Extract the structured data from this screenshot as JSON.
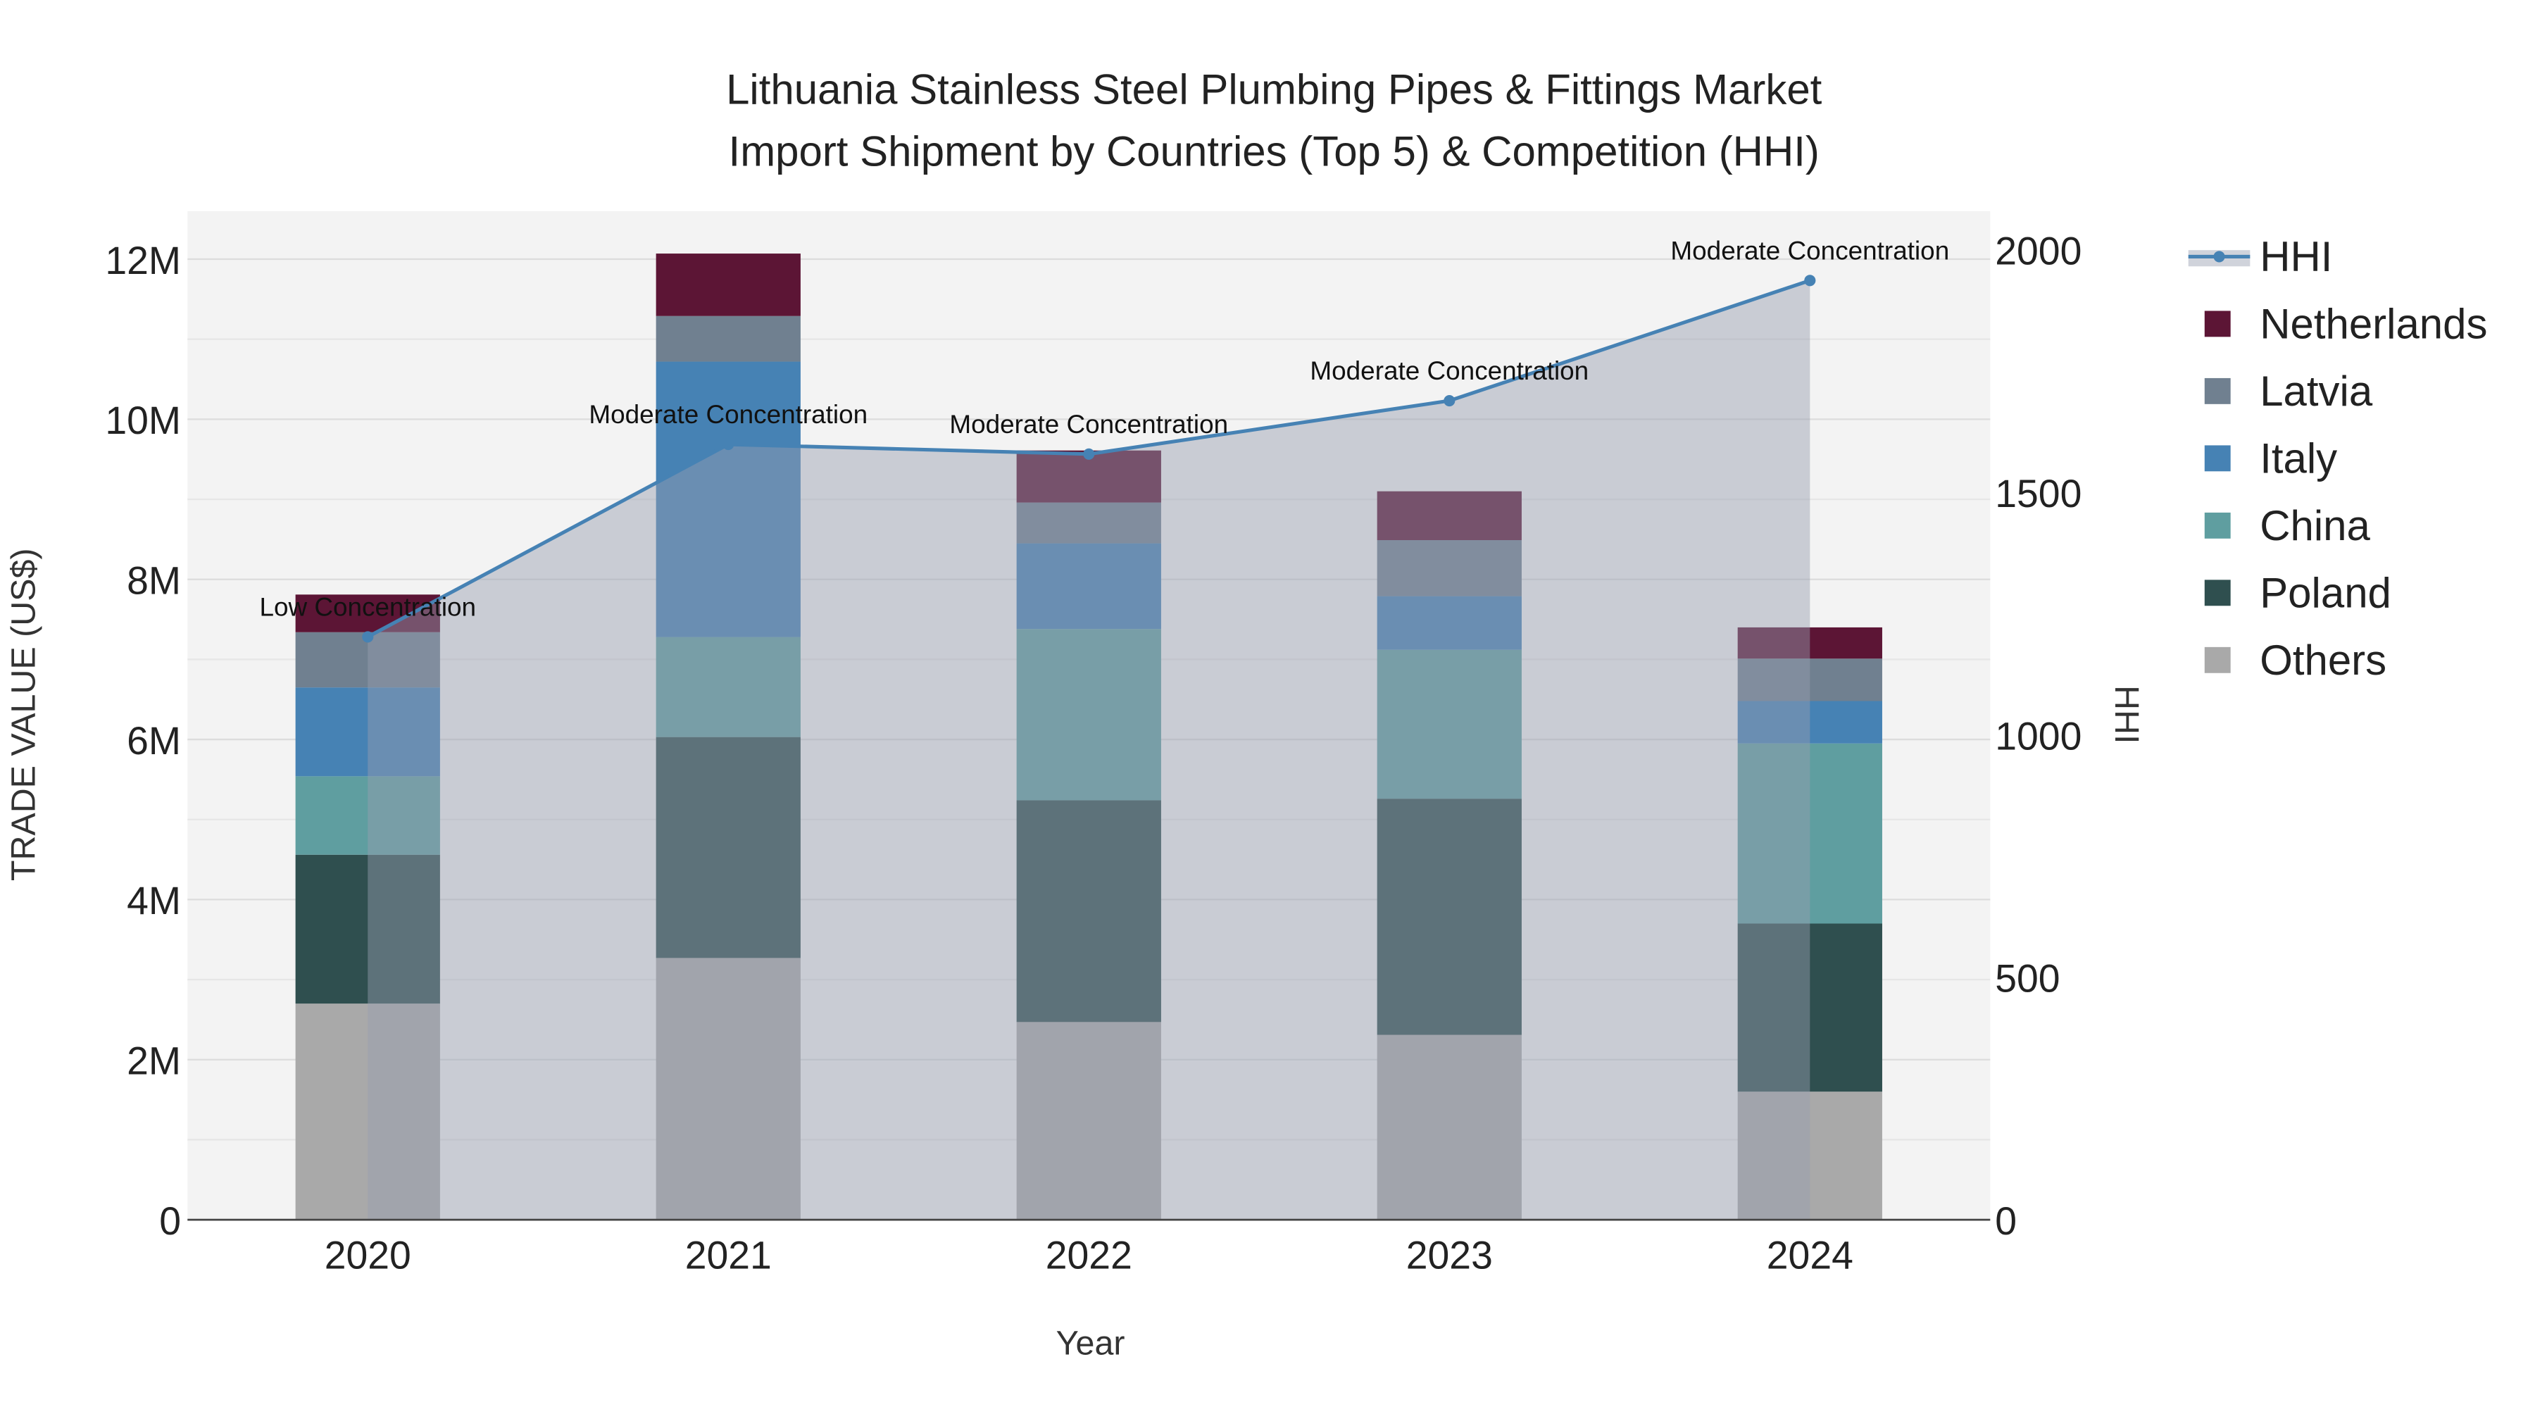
{
  "chart_data": {
    "type": "bar",
    "stacked": true,
    "title": [
      "Lithuania Stainless Steel Plumbing Pipes & Fittings Market",
      "Import Shipment by Countries (Top 5) & Competition (HHI)"
    ],
    "xlabel": "Year",
    "ylabel": "TRADE VALUE (US$)",
    "y2label": "HHI",
    "categories": [
      "2020",
      "2021",
      "2022",
      "2023",
      "2024"
    ],
    "ylim": [
      0,
      12600000
    ],
    "y2lim": [
      0,
      2080
    ],
    "yticks": [
      0,
      2000000,
      4000000,
      6000000,
      8000000,
      10000000,
      12000000
    ],
    "ytick_labels": [
      "0",
      "2M",
      "4M",
      "6M",
      "8M",
      "10M",
      "12M"
    ],
    "y2ticks": [
      0,
      500,
      1000,
      1500,
      2000
    ],
    "y2tick_labels": [
      "0",
      "500",
      "1000",
      "1500",
      "2000"
    ],
    "series": [
      {
        "name": "Others",
        "color": "#a9a9a9",
        "values": [
          2700000,
          3270000,
          2470000,
          2310000,
          1600000
        ]
      },
      {
        "name": "Poland",
        "color": "#2f4f4f",
        "values": [
          1860000,
          2760000,
          2770000,
          2950000,
          2100000
        ]
      },
      {
        "name": "China",
        "color": "#5f9ea0",
        "values": [
          980000,
          1250000,
          2140000,
          1860000,
          2250000
        ]
      },
      {
        "name": "Italy",
        "color": "#4682b4",
        "values": [
          1110000,
          3440000,
          1070000,
          670000,
          530000
        ]
      },
      {
        "name": "Latvia",
        "color": "#708090",
        "values": [
          690000,
          570000,
          510000,
          700000,
          530000
        ]
      },
      {
        "name": "Netherlands",
        "color": "#5c1535",
        "values": [
          470000,
          780000,
          650000,
          610000,
          390000
        ]
      }
    ],
    "line": {
      "name": "HHI",
      "color": "#4682b4",
      "axis": "right",
      "values": [
        1202,
        1599,
        1579,
        1689,
        1937
      ],
      "annotations": [
        "Low Concentration",
        "Moderate Concentration",
        "Moderate Concentration",
        "Moderate Concentration",
        "Moderate Concentration"
      ]
    },
    "legend": [
      "HHI",
      "Netherlands",
      "Latvia",
      "Italy",
      "China",
      "Poland",
      "Others"
    ],
    "legend_position": "right",
    "grid": true
  }
}
